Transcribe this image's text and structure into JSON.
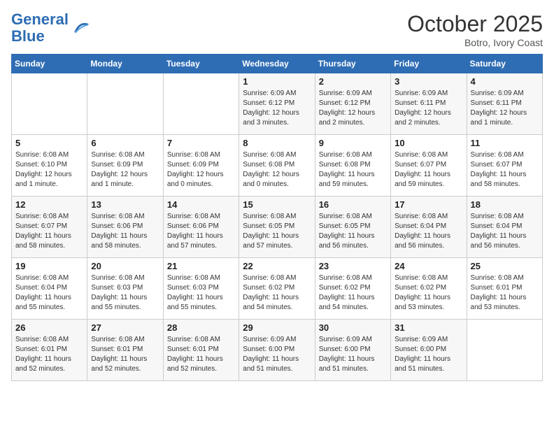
{
  "logo": {
    "line1": "General",
    "line2": "Blue"
  },
  "title": "October 2025",
  "location": "Botro, Ivory Coast",
  "days_of_week": [
    "Sunday",
    "Monday",
    "Tuesday",
    "Wednesday",
    "Thursday",
    "Friday",
    "Saturday"
  ],
  "weeks": [
    [
      {
        "day": "",
        "info": ""
      },
      {
        "day": "",
        "info": ""
      },
      {
        "day": "",
        "info": ""
      },
      {
        "day": "1",
        "info": "Sunrise: 6:09 AM\nSunset: 6:12 PM\nDaylight: 12 hours and 3 minutes."
      },
      {
        "day": "2",
        "info": "Sunrise: 6:09 AM\nSunset: 6:12 PM\nDaylight: 12 hours and 2 minutes."
      },
      {
        "day": "3",
        "info": "Sunrise: 6:09 AM\nSunset: 6:11 PM\nDaylight: 12 hours and 2 minutes."
      },
      {
        "day": "4",
        "info": "Sunrise: 6:09 AM\nSunset: 6:11 PM\nDaylight: 12 hours and 1 minute."
      }
    ],
    [
      {
        "day": "5",
        "info": "Sunrise: 6:08 AM\nSunset: 6:10 PM\nDaylight: 12 hours and 1 minute."
      },
      {
        "day": "6",
        "info": "Sunrise: 6:08 AM\nSunset: 6:09 PM\nDaylight: 12 hours and 1 minute."
      },
      {
        "day": "7",
        "info": "Sunrise: 6:08 AM\nSunset: 6:09 PM\nDaylight: 12 hours and 0 minutes."
      },
      {
        "day": "8",
        "info": "Sunrise: 6:08 AM\nSunset: 6:08 PM\nDaylight: 12 hours and 0 minutes."
      },
      {
        "day": "9",
        "info": "Sunrise: 6:08 AM\nSunset: 6:08 PM\nDaylight: 11 hours and 59 minutes."
      },
      {
        "day": "10",
        "info": "Sunrise: 6:08 AM\nSunset: 6:07 PM\nDaylight: 11 hours and 59 minutes."
      },
      {
        "day": "11",
        "info": "Sunrise: 6:08 AM\nSunset: 6:07 PM\nDaylight: 11 hours and 58 minutes."
      }
    ],
    [
      {
        "day": "12",
        "info": "Sunrise: 6:08 AM\nSunset: 6:07 PM\nDaylight: 11 hours and 58 minutes."
      },
      {
        "day": "13",
        "info": "Sunrise: 6:08 AM\nSunset: 6:06 PM\nDaylight: 11 hours and 58 minutes."
      },
      {
        "day": "14",
        "info": "Sunrise: 6:08 AM\nSunset: 6:06 PM\nDaylight: 11 hours and 57 minutes."
      },
      {
        "day": "15",
        "info": "Sunrise: 6:08 AM\nSunset: 6:05 PM\nDaylight: 11 hours and 57 minutes."
      },
      {
        "day": "16",
        "info": "Sunrise: 6:08 AM\nSunset: 6:05 PM\nDaylight: 11 hours and 56 minutes."
      },
      {
        "day": "17",
        "info": "Sunrise: 6:08 AM\nSunset: 6:04 PM\nDaylight: 11 hours and 56 minutes."
      },
      {
        "day": "18",
        "info": "Sunrise: 6:08 AM\nSunset: 6:04 PM\nDaylight: 11 hours and 56 minutes."
      }
    ],
    [
      {
        "day": "19",
        "info": "Sunrise: 6:08 AM\nSunset: 6:04 PM\nDaylight: 11 hours and 55 minutes."
      },
      {
        "day": "20",
        "info": "Sunrise: 6:08 AM\nSunset: 6:03 PM\nDaylight: 11 hours and 55 minutes."
      },
      {
        "day": "21",
        "info": "Sunrise: 6:08 AM\nSunset: 6:03 PM\nDaylight: 11 hours and 55 minutes."
      },
      {
        "day": "22",
        "info": "Sunrise: 6:08 AM\nSunset: 6:02 PM\nDaylight: 11 hours and 54 minutes."
      },
      {
        "day": "23",
        "info": "Sunrise: 6:08 AM\nSunset: 6:02 PM\nDaylight: 11 hours and 54 minutes."
      },
      {
        "day": "24",
        "info": "Sunrise: 6:08 AM\nSunset: 6:02 PM\nDaylight: 11 hours and 53 minutes."
      },
      {
        "day": "25",
        "info": "Sunrise: 6:08 AM\nSunset: 6:01 PM\nDaylight: 11 hours and 53 minutes."
      }
    ],
    [
      {
        "day": "26",
        "info": "Sunrise: 6:08 AM\nSunset: 6:01 PM\nDaylight: 11 hours and 52 minutes."
      },
      {
        "day": "27",
        "info": "Sunrise: 6:08 AM\nSunset: 6:01 PM\nDaylight: 11 hours and 52 minutes."
      },
      {
        "day": "28",
        "info": "Sunrise: 6:08 AM\nSunset: 6:01 PM\nDaylight: 11 hours and 52 minutes."
      },
      {
        "day": "29",
        "info": "Sunrise: 6:09 AM\nSunset: 6:00 PM\nDaylight: 11 hours and 51 minutes."
      },
      {
        "day": "30",
        "info": "Sunrise: 6:09 AM\nSunset: 6:00 PM\nDaylight: 11 hours and 51 minutes."
      },
      {
        "day": "31",
        "info": "Sunrise: 6:09 AM\nSunset: 6:00 PM\nDaylight: 11 hours and 51 minutes."
      },
      {
        "day": "",
        "info": ""
      }
    ]
  ]
}
